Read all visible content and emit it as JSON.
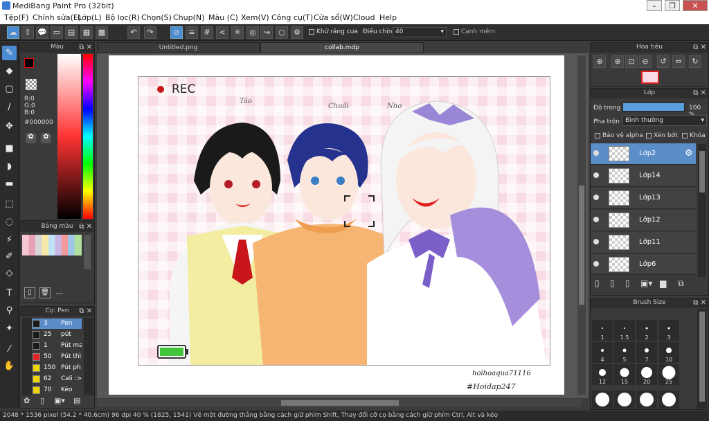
{
  "window": {
    "title": "MediBang Paint Pro (32bit)"
  },
  "menu": [
    "Tệp(F)",
    "Chỉnh sửa(E)",
    "Lớp(L)",
    "Bộ lọc(R)",
    "Chọn(S)",
    "Chụp(N)",
    "Màu (C)",
    "Xem(V)",
    "Công cụ(T)",
    "Cửa sổ(W)",
    "Cloud",
    "Help"
  ],
  "toolbar": {
    "antialias_label": "Khử răng cưa",
    "adjust_label": "Điều chỉnh",
    "adjust_value": "40",
    "sharp_label": "Cạnh mềm"
  },
  "tabs": [
    "Untitled.png",
    "collab.mdp"
  ],
  "color_panel": {
    "title": "Màu",
    "r": "R:0",
    "g": "G:0",
    "b": "B:0",
    "hex": "#000000"
  },
  "palette_panel": {
    "title": "Bảng màu",
    "value": "---"
  },
  "brush_panel": {
    "title": "Cọ: Pen",
    "items": [
      {
        "size": "3",
        "name": "Pen",
        "color": "#1a1a1a"
      },
      {
        "size": "25",
        "name": "pút",
        "color": "#1a1a1a"
      },
      {
        "size": "1",
        "name": "Pút ma",
        "color": "#1a1a1a"
      },
      {
        "size": "50",
        "name": "Pút thì",
        "color": "#e0262b"
      },
      {
        "size": "150",
        "name": "Pút ph",
        "color": "#f0d400"
      },
      {
        "size": "62",
        "name": "Cali :>",
        "color": "#f0d400"
      },
      {
        "size": "70",
        "name": "Kéo",
        "color": "#f0d400"
      }
    ]
  },
  "navigator_panel": {
    "title": "Hoa tiêu"
  },
  "layer_panel": {
    "title": "Lớp",
    "opacity_label": "Độ trong",
    "opacity_value": "100 %",
    "blend_label": "Pha trộn",
    "blend_value": "Bình thường",
    "protect_alpha": "Bảo vệ alpha",
    "clip": "Xén bớt",
    "lock": "Khóa",
    "layers": [
      "Lớp2",
      "Lớp14",
      "Lớp13",
      "Lớp12",
      "Lớp11",
      "Lớp6"
    ]
  },
  "brush_size_panel": {
    "title": "Brush Size",
    "sizes": [
      "1",
      "1.5",
      "2",
      "3",
      "4",
      "5",
      "7",
      "10",
      "12",
      "15",
      "20",
      "25"
    ]
  },
  "artwork": {
    "rec": "REC",
    "name1": "Táo",
    "name2": "Chuối",
    "name3": "Nho",
    "sign1": "hoihoaqua71116",
    "sign2": "#Hoidap247"
  },
  "status": {
    "text": "2048 * 1536 pixel  (54.2 * 40.6cm)  96 dpi  40 %  (1825, 1541)  Vẽ một đường thẳng bằng cách giữ phím Shift, Thay đổi cỡ cọ bằng cách giữ phím Ctrl, Alt và kéo"
  }
}
